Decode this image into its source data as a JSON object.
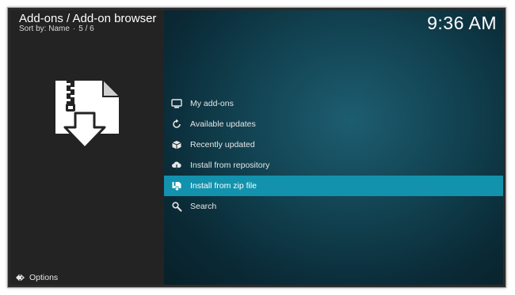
{
  "header": {
    "title": "Add-ons / Add-on browser",
    "sort_label": "Sort by: Name",
    "position": "5 / 6",
    "clock": "9:36 AM"
  },
  "menu": {
    "items": [
      {
        "label": "My add-ons",
        "icon": "monitor-icon"
      },
      {
        "label": "Available updates",
        "icon": "refresh-icon"
      },
      {
        "label": "Recently updated",
        "icon": "box-icon"
      },
      {
        "label": "Install from repository",
        "icon": "cloud-download-icon"
      },
      {
        "label": "Install from zip file",
        "icon": "zip-install-icon",
        "selected": true
      },
      {
        "label": "Search",
        "icon": "search-icon"
      }
    ]
  },
  "footer": {
    "options_label": "Options"
  },
  "colors": {
    "left_panel": "#232323",
    "selection": "#1292ad",
    "text": "#e6e6e6"
  }
}
